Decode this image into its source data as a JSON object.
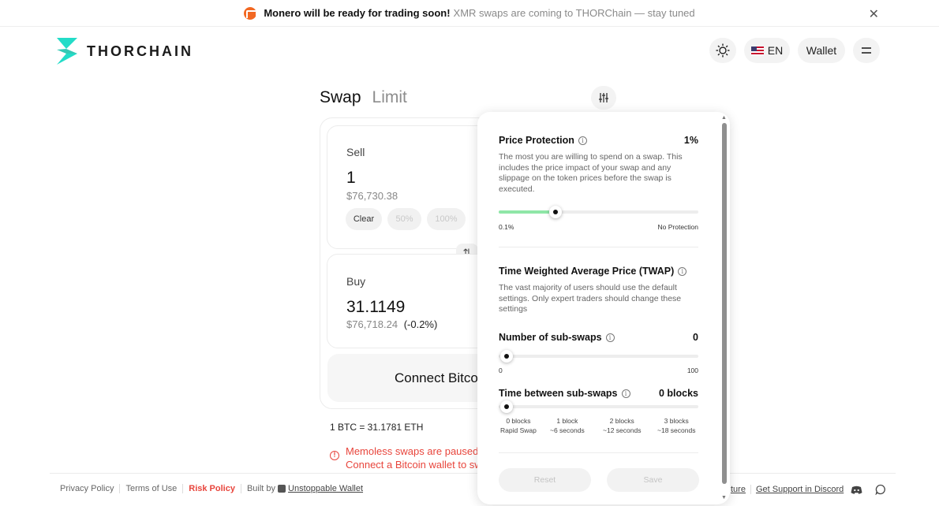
{
  "banner": {
    "headline": "Monero will be ready for trading soon!",
    "subtext": "XMR swaps are coming to THORChain — stay tuned"
  },
  "header": {
    "logo_text": "THORCHAIN",
    "language": "EN",
    "wallet_label": "Wallet"
  },
  "tabs": {
    "swap": "Swap",
    "limit": "Limit"
  },
  "sell": {
    "label": "Sell",
    "amount": "1",
    "usd": "$76,730.38",
    "buttons": [
      "Clear",
      "50%",
      "100%"
    ]
  },
  "buy": {
    "label": "Buy",
    "amount": "31.1149",
    "usd": "$76,718.24",
    "change": "(-0.2%)"
  },
  "connect_label": "Connect Bitcoin Wallet",
  "rate": "1 BTC = 31.1781 ETH",
  "warning": {
    "line1": "Memoless swaps are paused by THORChain",
    "line2": "Connect a Bitcoin wallet to swap"
  },
  "footer": {
    "privacy": "Privacy Policy",
    "terms": "Terms of Use",
    "risk": "Risk Policy",
    "built_by": "Built by",
    "built_by_name": "Unstoppable Wallet",
    "feature": "ture",
    "support": "Get Support in Discord"
  },
  "settings": {
    "price_protection": {
      "title": "Price Protection",
      "value": "1%",
      "description": "The most you are willing to spend on a swap. This includes the price impact of your swap and any slippage on the token prices before the swap is executed.",
      "min_label": "0.1%",
      "max_label": "No Protection",
      "level_fraction": 0.26
    },
    "twap": {
      "title": "Time Weighted Average Price (TWAP)",
      "description": "The vast majority of users should use the default settings. Only expert traders should change these settings"
    },
    "sub_swaps": {
      "title": "Number of sub-swaps",
      "value": "0",
      "min_label": "0",
      "max_label": "100",
      "level_fraction": 0
    },
    "interval": {
      "title": "Time between sub-swaps",
      "value": "0 blocks",
      "ticks": [
        {
          "top": "0 blocks",
          "bottom": "Rapid Swap"
        },
        {
          "top": "1 block",
          "bottom": "~6 seconds"
        },
        {
          "top": "2 blocks",
          "bottom": "~12 seconds"
        },
        {
          "top": "3 blocks",
          "bottom": "~18 seconds"
        }
      ],
      "level_fraction": 0
    },
    "reset_label": "Reset",
    "save_label": "Save"
  },
  "colors": {
    "accent_green": "#8fe6a7",
    "warning_red": "#e8453c",
    "brand_teal": "#23dcc8"
  }
}
